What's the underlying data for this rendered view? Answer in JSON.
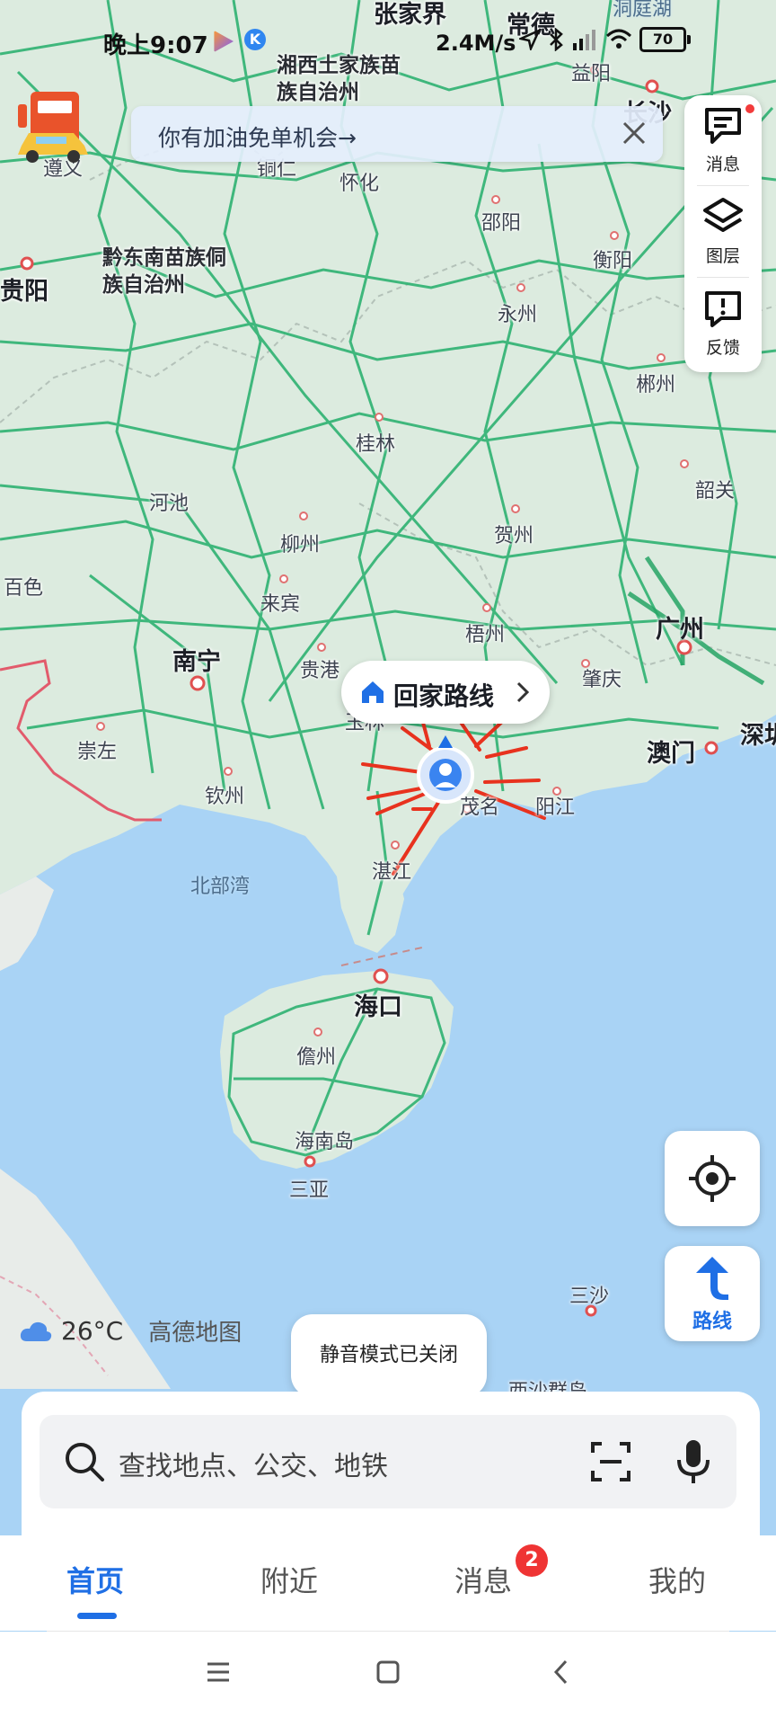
{
  "status_bar": {
    "time": "晚上9:07",
    "network_speed": "2.4M/s",
    "battery": "70",
    "icons": [
      "play-icon",
      "app-k-icon",
      "location-arrow-icon",
      "bluetooth-icon",
      "signal-icon",
      "wifi-icon"
    ]
  },
  "promo": {
    "text": "你有加油免单机会→",
    "icon": "gas-station-car-icon",
    "close_icon": "close-icon"
  },
  "tools": [
    {
      "label": "消息",
      "icon": "message-icon",
      "has_dot": true
    },
    {
      "label": "图层",
      "icon": "layers-icon",
      "has_dot": false
    },
    {
      "label": "反馈",
      "icon": "feedback-icon",
      "has_dot": false
    }
  ],
  "map_labels": {
    "zhangjiajie": "张家界",
    "changde": "常德",
    "dongtinghu": "洞庭湖",
    "yiyang": "益阳",
    "changsha": "长沙",
    "xiangxi": "湘西土家族苗族自治州",
    "huaihua": "怀化",
    "tongren": "铜仁",
    "zunyi": "遵义",
    "shaoyang": "邵阳",
    "hengyang": "衡阳",
    "qiandongnan": "黔东南苗族侗族自治州",
    "guiyang": "贵阳",
    "yongzhou": "永州",
    "chenzhou": "郴州",
    "guilin": "桂林",
    "shaoguan": "韶关",
    "hechi": "河池",
    "hezhou": "贺州",
    "liuzhou": "柳州",
    "baise": "百色",
    "laibin": "来宾",
    "wuzhou": "梧州",
    "guangzhou": "广州",
    "nanning": "南宁",
    "guigang": "贵港",
    "zhaoqing": "肇庆",
    "yulin": "玉林",
    "shenzhen": "深圳",
    "chongzuo": "崇左",
    "macau": "澳门",
    "qinzhou": "钦州",
    "maoming": "茂名",
    "yangjiang": "阳江",
    "beibuwan": "北部湾",
    "zhanjiang": "湛江",
    "haikou": "海口",
    "danzhou": "儋州",
    "hainandao": "海南岛",
    "sanya": "三亚",
    "sansha": "三沙",
    "xisha": "西沙群岛"
  },
  "route_bubble": {
    "label": "回家路线",
    "icon": "home-icon"
  },
  "locate_button": {
    "icon": "locate-icon"
  },
  "route_button": {
    "label": "路线",
    "icon": "route-arrow-icon"
  },
  "weather": {
    "temperature": "26°C",
    "icon": "cloud-icon",
    "logo": "高德地图"
  },
  "toast": {
    "text": "静音模式已关闭"
  },
  "search": {
    "placeholder": "查找地点、公交、地铁"
  },
  "tabs": [
    {
      "label": "首页",
      "active": true
    },
    {
      "label": "附近",
      "active": false
    },
    {
      "label": "消息",
      "active": false,
      "badge": "2"
    },
    {
      "label": "我的",
      "active": false
    }
  ],
  "colors": {
    "accent": "#1f6fe5",
    "road": "#22a86b",
    "sea": "#a6d2f7",
    "land": "#dfece4",
    "badge": "#ef3434"
  }
}
